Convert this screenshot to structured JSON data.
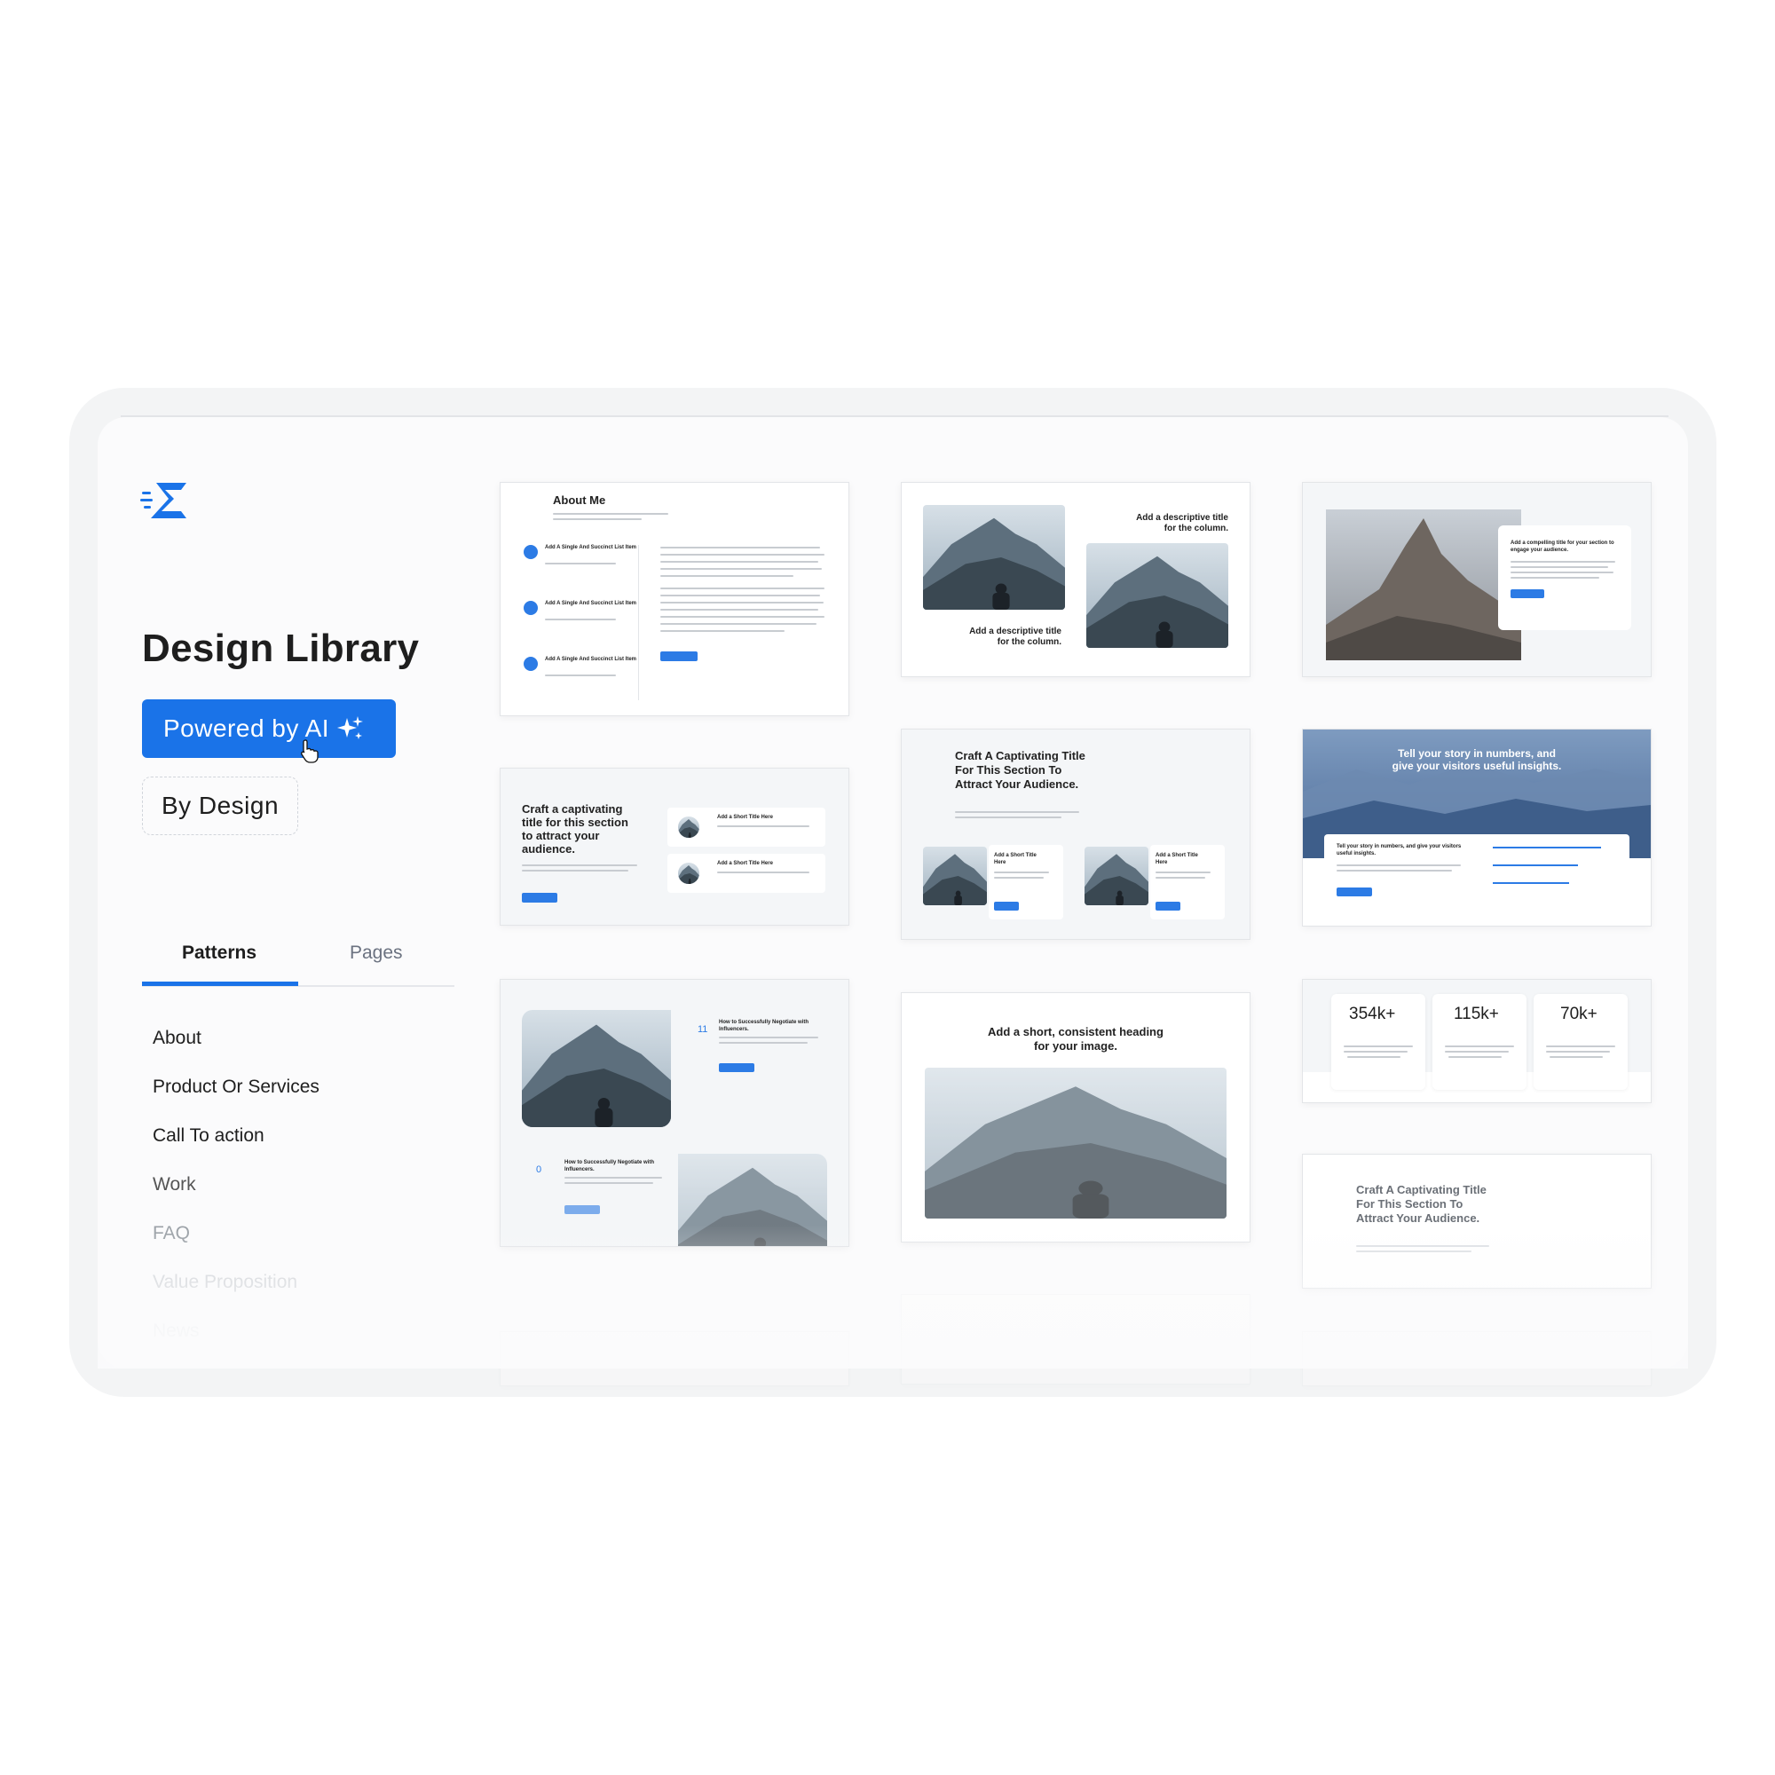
{
  "sidebar": {
    "title": "Design Library",
    "powered_label": "Powered by AI",
    "by_design_label": "By Design",
    "tabs": [
      {
        "label": "Patterns",
        "active": true
      },
      {
        "label": "Pages",
        "active": false
      }
    ],
    "categories": [
      {
        "label": "About"
      },
      {
        "label": "Product Or Services"
      },
      {
        "label": "Call To action"
      },
      {
        "label": "Work"
      },
      {
        "label": "FAQ"
      },
      {
        "label": "Value Proposition"
      },
      {
        "label": "News"
      }
    ]
  },
  "cards": {
    "c1": {
      "title": "About Me",
      "items": [
        "Add A Single And Succinct List Item",
        "Add A Single And Succinct List Item",
        "Add A Single And Succinct List Item"
      ]
    },
    "c2": {
      "title_top": "Add a descriptive title for the column.",
      "title_bottom": "Add a descriptive title for the column."
    },
    "c3": {
      "title": "Add a compelling title for your section to engage your audience."
    },
    "c4": {
      "title": "Craft a captivating title for this section to attract your audience.",
      "item1": "Add a Short Title Here",
      "item2": "Add a Short Title Here"
    },
    "c5": {
      "title": "Craft A Captivating Title For This Section To Attract Your Audience.",
      "item1": "Add a Short Title Here",
      "item2": "Add a Short Title Here"
    },
    "c6": {
      "title": "Tell your story in numbers, and give your visitors useful insights.",
      "subtitle": "Tell your story in numbers, and give your visitors useful insights."
    },
    "c7": {
      "post1": "How to Successfully Negotiate with Influencers.",
      "post2": "How to Successfully Negotiate with Influencers.",
      "date1": "11",
      "date2": "0"
    },
    "c8": {
      "title": "Add a short, consistent heading for your image."
    },
    "c9": {
      "stats": [
        "354k+",
        "115k+",
        "70k+"
      ]
    },
    "c10": {
      "title": "Craft A Captivating Title For This Section To Attract Your Audience."
    }
  },
  "colors": {
    "accent": "#1a73e8",
    "frame": "#f3f4f5"
  },
  "icons": [
    "logo-icon",
    "sparkle-icon",
    "pointer-cursor-icon"
  ]
}
